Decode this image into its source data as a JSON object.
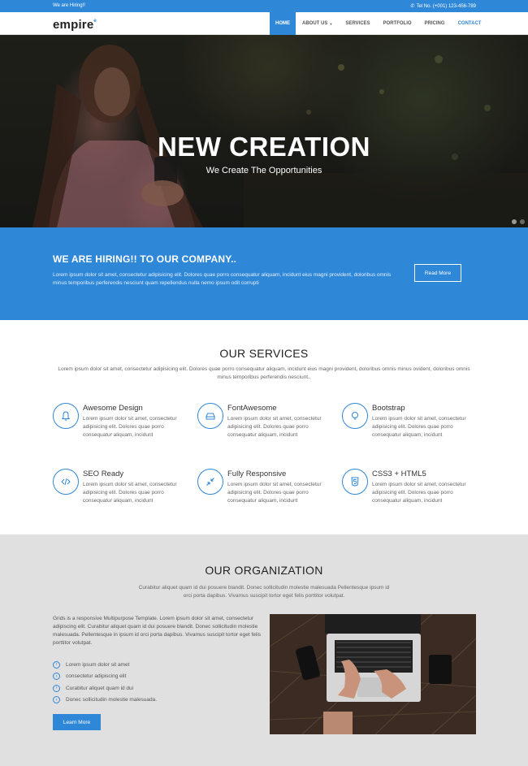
{
  "topbar": {
    "hiring_text": "We are Hiring!!",
    "tel_text": "Tel No. (+001) 123-456-789"
  },
  "nav": {
    "logo": "empire",
    "items": [
      {
        "label": "HOME",
        "active": true
      },
      {
        "label": "ABOUT US",
        "dropdown": true
      },
      {
        "label": "SERVICES"
      },
      {
        "label": "PORTFOLIO"
      },
      {
        "label": "PRICING"
      },
      {
        "label": "CONTACT"
      }
    ]
  },
  "hero": {
    "title": "NEW CREATION",
    "subtitle": "We Create The Opportunities"
  },
  "hiring_band": {
    "title": "WE ARE HIRING!! TO OUR COMPANY..",
    "text": "Lorem ipsum dolor sit amet, consectetur adipisicing elit. Dolores quae porro consequatur aliquam, incidunt eius magni provident, doloribus omnis minus temporibus perferendis nesciunt quam repellendus nulla nemo ipsum odit corrupti",
    "button": "Read More"
  },
  "services": {
    "title": "OUR SERVICES",
    "description": "Lorem ipsum dolor sit amet, consectetur adipisicing elit. Dolores quae porro consequatur aliquam, incidunt eius magni provident, doloribus omnis minus ovident, doloribus omnis minus temporibus perferendis nesciunt..",
    "items": [
      {
        "icon": "bell-icon",
        "title": "Awesome Design",
        "text": "Lorem ipsum dolor sit amet, consectetur adipisicing elit. Dolores quae porro consequatur aliquam, incidunt"
      },
      {
        "icon": "drive-icon",
        "title": "FontAwesome",
        "text": "Lorem ipsum dolor sit amet, consectetur adipisicing elit. Dolores quae porro consequatur aliquam, incidunt"
      },
      {
        "icon": "lightbulb-icon",
        "title": "Bootstrap",
        "text": "Lorem ipsum dolor sit amet, consectetur adipisicing elit. Dolores quae porro consequatur aliquam, incidunt"
      },
      {
        "icon": "code-icon",
        "title": "SEO Ready",
        "text": "Lorem ipsum dolor sit amet, consectetur adipisicing elit. Dolores quae porro consequatur aliquam, incidunt"
      },
      {
        "icon": "compress-icon",
        "title": "Fully Responsive",
        "text": "Lorem ipsum dolor sit amet, consectetur adipisicing elit. Dolores quae porro consequatur aliquam, incidunt"
      },
      {
        "icon": "html5-icon",
        "title": "CSS3 + HTML5",
        "text": "Lorem ipsum dolor sit amet, consectetur adipisicing elit. Dolores quae porro consequatur aliquam, incidunt"
      }
    ]
  },
  "organization": {
    "title": "OUR ORGANIZATION",
    "lead": "Curabitur aliquet quam id dui posuere blandit. Donec sollicitudin molestie malesuada Pellentesque ipsum id orci porta dapibus. Vivamus suscipit tortor eget felis porttitor volutpat.",
    "paragraph": "Grids is a responsive Multipurpose Template. Lorem ipsum dolor sit amet, consectetur adipiscing elit. Curabitur aliquet quam id dui posuere blandit. Donec sollicitudin molestie malesuada. Pellentesque in ipsum id orci porta dapibus. Vivamus suscipit tortor eget felis porttitor volutpat.",
    "list": [
      "Lorem ipsum dolor sit amet",
      "consectetur adipiscing elit",
      "Curabitur aliquet quam id dui",
      "Donec sollicitudin molestie malesuada."
    ],
    "button": "Learn More"
  },
  "colors": {
    "accent": "#2f87d8",
    "org_background": "#e0e0e0"
  }
}
